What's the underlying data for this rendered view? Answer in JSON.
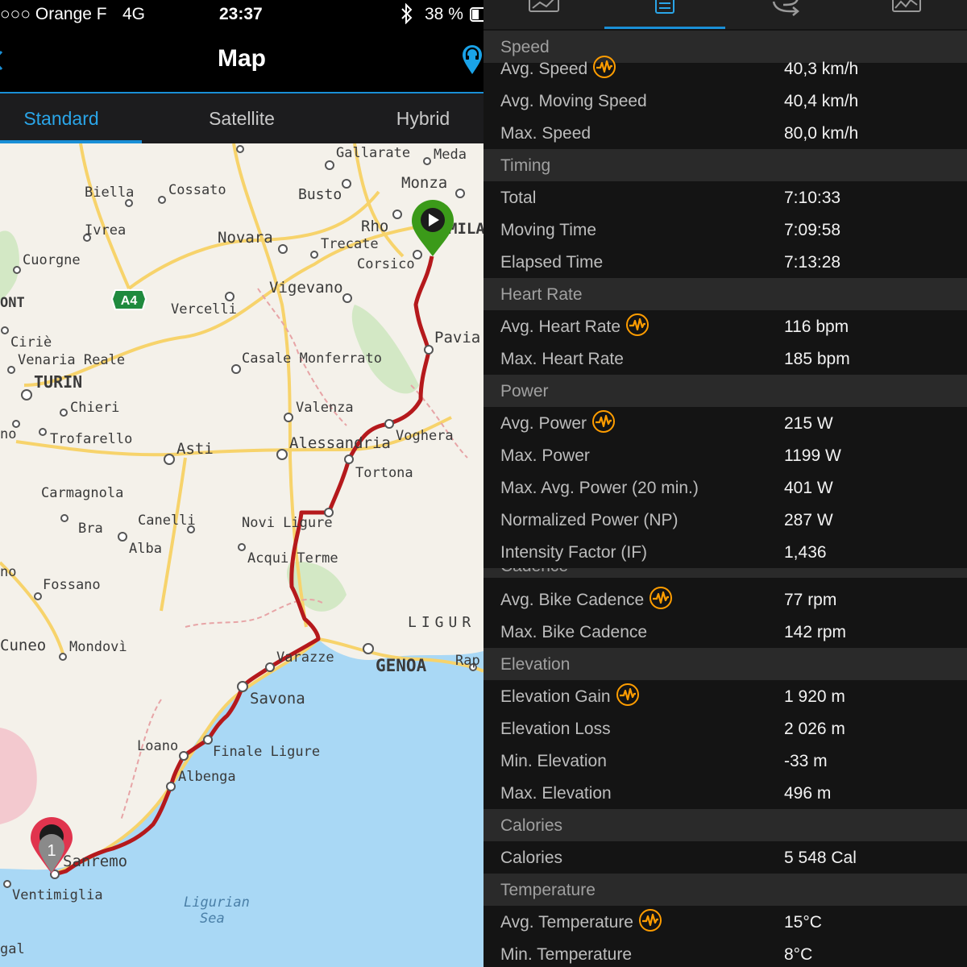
{
  "status_bar": {
    "carrier": "○○○ Orange F",
    "network": "4G",
    "time": "23:37",
    "battery": "38 %",
    "bluetooth_icon": "bluetooth-icon"
  },
  "nav": {
    "title": "Map",
    "right_icon": "headset-pin-icon"
  },
  "map_tabs": [
    {
      "label": "Standard",
      "active": true
    },
    {
      "label": "Satellite",
      "active": false
    },
    {
      "label": "Hybrid",
      "active": false
    }
  ],
  "map": {
    "places": [
      "Gallarate",
      "Meda",
      "Monza",
      "Biella",
      "Cossato",
      "Busto",
      "Rho",
      "MILA",
      "Ivrea",
      "Novara",
      "Trecate",
      "Corsico",
      "Cuorgne",
      "Vigevano",
      "ONT",
      "A4",
      "Vercelli",
      "Pavia",
      "Ciriè",
      "Venaria Reale",
      "Casale Monferrato",
      "TURIN",
      "Chieri",
      "Valenza",
      "Trofarello",
      "Asti",
      "Alessandria",
      "Voghera",
      "Tortona",
      "Carmagnola",
      "Canelli",
      "Novi Ligure",
      "Bra",
      "Alba",
      "Acqui Terme",
      "Fossano",
      "LIGUR",
      "Cuneo",
      "Mondovì",
      "Varazze",
      "GENOA",
      "Rap",
      "Savona",
      "Loano",
      "Finale Ligure",
      "Albenga",
      "Sanremo",
      "Ventimiglia",
      "Ligurian",
      "Sea",
      "gal",
      "no",
      "no"
    ],
    "start_marker_icon": "play-icon",
    "end_marker_label": "1",
    "route_color": "#b5191c",
    "start_color": "#3b9a19",
    "end_color": "#e0344e"
  },
  "stats_tabs": [
    "stats-chart-icon",
    "list-icon",
    "laps-icon",
    "graph-icon"
  ],
  "stats": {
    "accent": "#ff9d00",
    "sections": [
      {
        "title": "Speed",
        "rows": [
          {
            "label": "Avg. Speed",
            "value": "40,3 km/h",
            "badge": true
          },
          {
            "label": "Avg. Moving Speed",
            "value": "40,4 km/h",
            "badge": false
          },
          {
            "label": "Max. Speed",
            "value": "80,0 km/h",
            "badge": false
          }
        ]
      },
      {
        "title": "Timing",
        "rows": [
          {
            "label": "Total",
            "value": "7:10:33",
            "badge": false
          },
          {
            "label": "Moving Time",
            "value": "7:09:58",
            "badge": false
          },
          {
            "label": "Elapsed Time",
            "value": "7:13:28",
            "badge": false
          }
        ]
      },
      {
        "title": "Heart Rate",
        "rows": [
          {
            "label": "Avg. Heart Rate",
            "value": "116 bpm",
            "badge": true
          },
          {
            "label": "Max. Heart Rate",
            "value": "185 bpm",
            "badge": false
          }
        ]
      },
      {
        "title": "Power",
        "rows": [
          {
            "label": "Avg. Power",
            "value": "215 W",
            "badge": true
          },
          {
            "label": "Max. Power",
            "value": "1199 W",
            "badge": false
          },
          {
            "label": "Max. Avg. Power (20 min.)",
            "value": "401 W",
            "badge": false
          },
          {
            "label": "Normalized Power (NP)",
            "value": "287 W",
            "badge": false
          },
          {
            "label": "Intensity Factor (IF)",
            "value": "1,436",
            "badge": false
          }
        ]
      },
      {
        "title": "Cadence",
        "rows": [
          {
            "label": "Avg. Bike Cadence",
            "value": "77 rpm",
            "badge": true
          },
          {
            "label": "Max. Bike Cadence",
            "value": "142 rpm",
            "badge": false
          }
        ]
      },
      {
        "title": "Elevation",
        "rows": [
          {
            "label": "Elevation Gain",
            "value": "1 920 m",
            "badge": true
          },
          {
            "label": "Elevation Loss",
            "value": "2 026 m",
            "badge": false
          },
          {
            "label": "Min. Elevation",
            "value": "-33 m",
            "badge": false
          },
          {
            "label": "Max. Elevation",
            "value": "496 m",
            "badge": false
          }
        ]
      },
      {
        "title": "Calories",
        "rows": [
          {
            "label": "Calories",
            "value": "5 548 Cal",
            "badge": false
          }
        ]
      },
      {
        "title": "Temperature",
        "rows": [
          {
            "label": "Avg. Temperature",
            "value": "15°C",
            "badge": true
          },
          {
            "label": "Min. Temperature",
            "value": "8°C",
            "badge": false
          }
        ]
      }
    ]
  }
}
